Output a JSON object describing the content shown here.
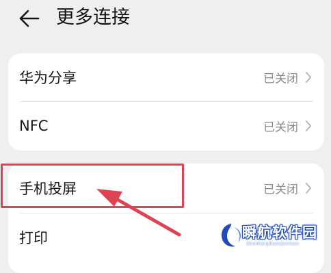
{
  "header": {
    "title": "更多连接",
    "back_icon": "arrow-left-icon"
  },
  "section1": {
    "items": [
      {
        "label": "华为分享",
        "status": "已关闭"
      },
      {
        "label": "NFC",
        "status": "已关闭"
      }
    ]
  },
  "section2": {
    "items": [
      {
        "label": "手机投屏",
        "status": "已关闭"
      },
      {
        "label": "打印",
        "status": ""
      }
    ]
  },
  "annotation": {
    "color": "#de4353"
  },
  "watermark": {
    "text": "瞬航软件园",
    "subtext": "ShunHangRuanJianYuan"
  },
  "colors": {
    "background": "#efefef",
    "card": "#ffffff",
    "status_text": "#8a8a8a",
    "highlight": "#de4353"
  }
}
